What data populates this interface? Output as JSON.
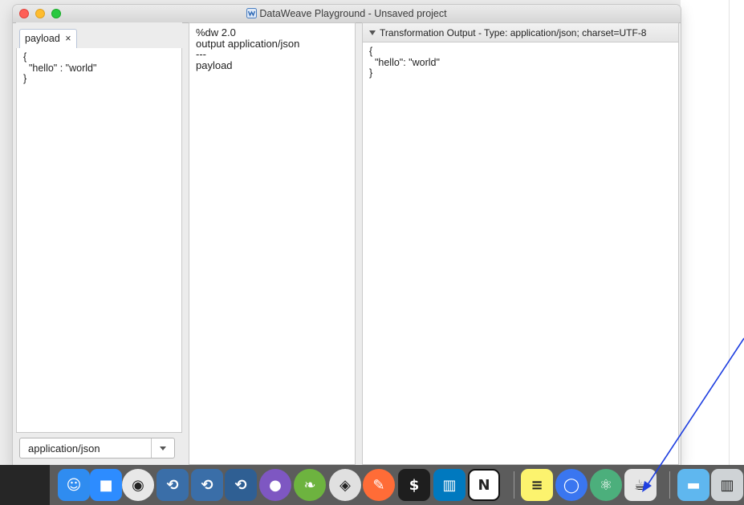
{
  "window": {
    "title": "DataWeave Playground - Unsaved project"
  },
  "input": {
    "tab_label": "payload",
    "tab_close": "×",
    "lines": [
      "{",
      "  \"hello\" : \"world\"",
      "}"
    ],
    "mime_select": "application/json"
  },
  "script": {
    "lines": [
      "%dw 2.0",
      "output application/json",
      "---",
      "payload"
    ]
  },
  "output": {
    "header": "Transformation Output - Type: application/json; charset=UTF-8",
    "lines": [
      "{",
      "  \"hello\": \"world\"",
      "}"
    ]
  },
  "dock": {
    "apps": [
      {
        "name": "finder-icon",
        "color": "#2f8cf0"
      },
      {
        "name": "zoom-icon",
        "color": "#2d8cff"
      },
      {
        "name": "chrome-icon",
        "color": "#e8e8e8"
      },
      {
        "name": "anypoint-studio-icon",
        "color": "#3a6ea8"
      },
      {
        "name": "anypoint-studio-2-icon",
        "color": "#3a6ea8"
      },
      {
        "name": "anypoint-studio-3-icon",
        "color": "#2f5f93"
      },
      {
        "name": "github-desktop-icon",
        "color": "#7e57c2"
      },
      {
        "name": "spring-tools-icon",
        "color": "#6db33f"
      },
      {
        "name": "sourcetree-icon",
        "color": "#e0e0e0"
      },
      {
        "name": "postman-icon",
        "color": "#ff6c37"
      },
      {
        "name": "terminal-icon",
        "color": "#1e1e1e"
      },
      {
        "name": "trello-icon",
        "color": "#0079bf"
      },
      {
        "name": "notion-icon",
        "color": "#ffffff"
      },
      {
        "name": "notes-icon",
        "color": "#fcf36e"
      },
      {
        "name": "signal-icon",
        "color": "#3a76f0"
      },
      {
        "name": "atom-icon",
        "color": "#4caf7c"
      },
      {
        "name": "java-icon",
        "color": "#e6e6e6"
      },
      {
        "name": "folder-icon",
        "color": "#5fb7ef"
      },
      {
        "name": "trash-icon",
        "color": "#cfd3d6"
      }
    ]
  }
}
